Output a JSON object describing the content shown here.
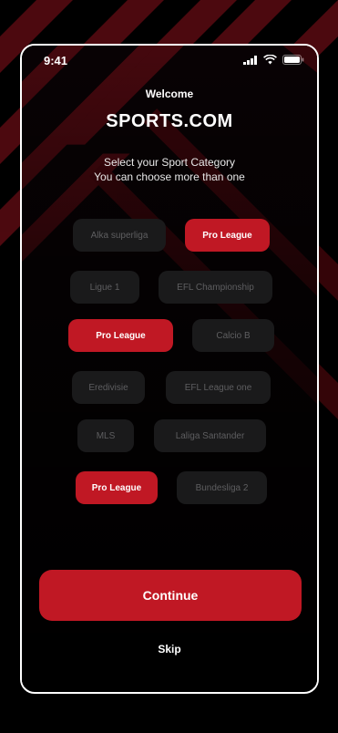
{
  "status_bar": {
    "time": "9:41"
  },
  "header": {
    "welcome": "Welcome",
    "brand": "SPORTS.COM"
  },
  "subtitle": {
    "line1": "Select your Sport Category",
    "line2": "You can choose more than one"
  },
  "categories": [
    {
      "label": "Alka superliga",
      "selected": false
    },
    {
      "label": "Pro League",
      "selected": true
    },
    {
      "label": "Ligue 1",
      "selected": false
    },
    {
      "label": "EFL Championship",
      "selected": false
    },
    {
      "label": "Pro League",
      "selected": true
    },
    {
      "label": "Calcio B",
      "selected": false
    },
    {
      "label": "Eredivisie",
      "selected": false
    },
    {
      "label": "EFL League one",
      "selected": false
    },
    {
      "label": "MLS",
      "selected": false
    },
    {
      "label": "Laliga Santander",
      "selected": false
    },
    {
      "label": "Pro League",
      "selected": true
    },
    {
      "label": "Bundesliga 2",
      "selected": false
    }
  ],
  "actions": {
    "continue_label": "Continue",
    "skip_label": "Skip"
  },
  "colors": {
    "accent": "#c01824",
    "chip_off": "#1a1a1b",
    "chip_off_text": "#5e5e60",
    "background": "#000000"
  }
}
